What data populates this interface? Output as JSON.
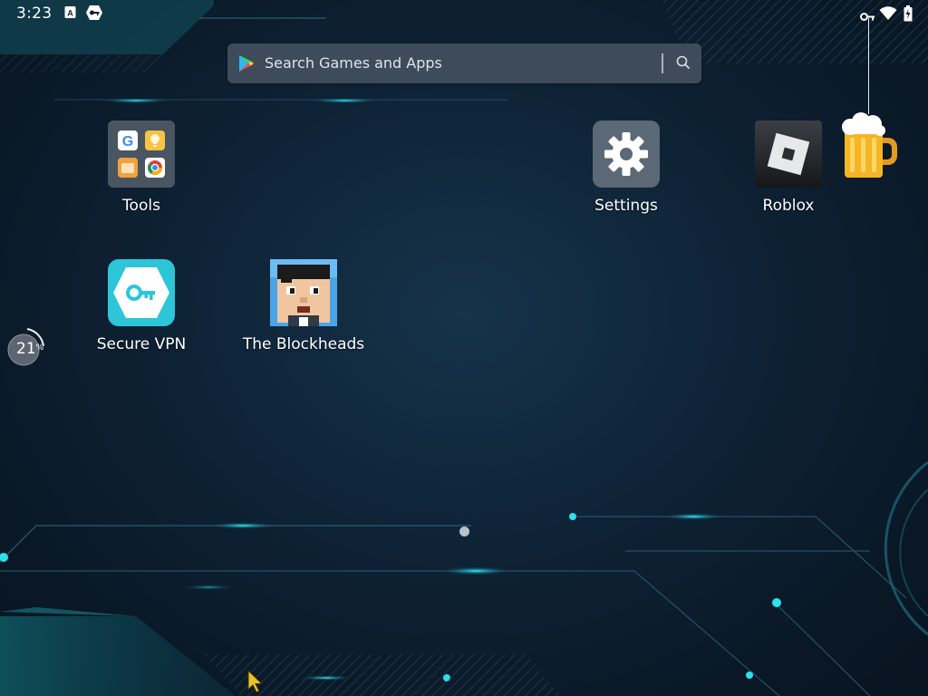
{
  "status_bar": {
    "time": "3:23",
    "left_icons": [
      "keyboard-a-icon",
      "vpn-key-badge-icon"
    ],
    "right_icons": [
      "vpn-key-icon",
      "wifi-icon",
      "battery-charging-icon"
    ]
  },
  "search": {
    "placeholder": "Search Games and Apps",
    "icons": [
      "play-store-icon",
      "search-icon"
    ]
  },
  "apps": [
    {
      "label": "Tools",
      "icon": "tools-folder-icon"
    },
    {
      "label": "Settings",
      "icon": "gear-icon"
    },
    {
      "label": "Roblox",
      "icon": "roblox-icon"
    },
    {
      "label": "Secure VPN",
      "icon": "key-icon"
    },
    {
      "label": "The Blockheads",
      "icon": "blockhead-face-icon"
    }
  ],
  "memory_widget": {
    "value": "21",
    "unit": "%"
  },
  "pager": {
    "pages": 1,
    "current": 1
  },
  "colors": {
    "background": "#0e2235",
    "search_bar": "#3d4b5a",
    "accent_glow": "#1fd3e0",
    "vpn_icon": "#2cc6d8",
    "settings_icon": "#5b6876"
  }
}
